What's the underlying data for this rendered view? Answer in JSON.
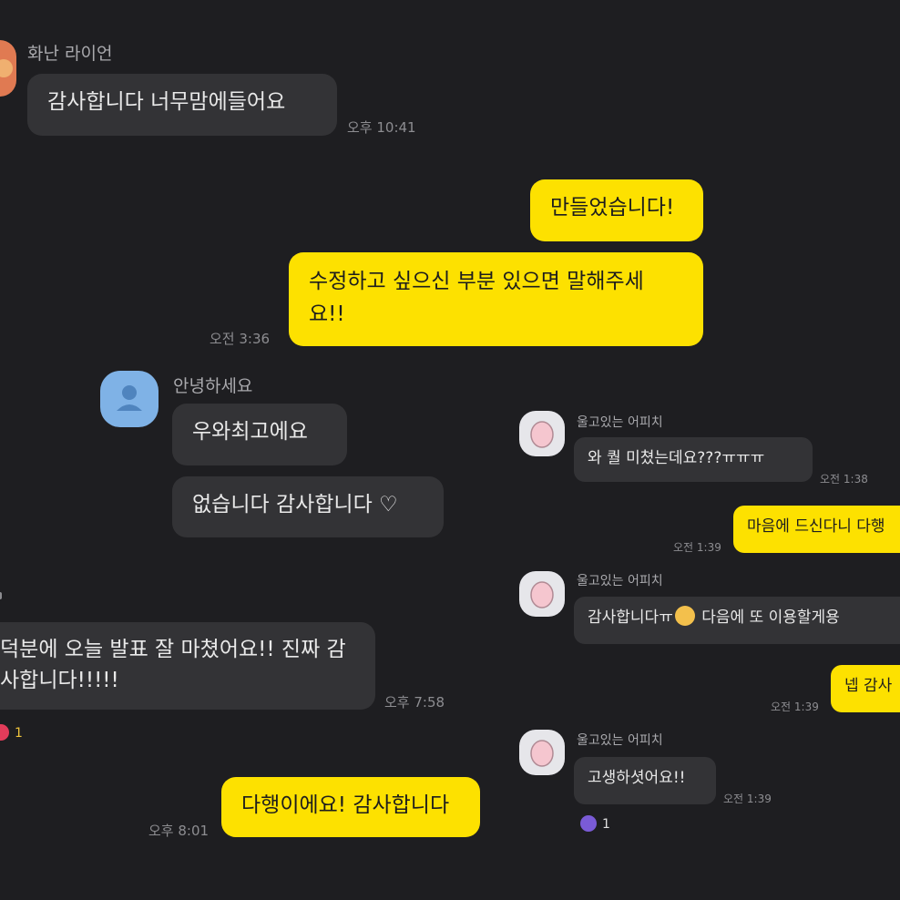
{
  "chats": {
    "hwanan": {
      "sender": "화난 라이언",
      "message": "감사합니다 너무맘에들어요",
      "time": "오후 10:41"
    },
    "mine1": {
      "messages": [
        "만들었습니다!",
        "수정하고 싶으신 부분 있으면 말해주세",
        "요!!"
      ],
      "time": "오전 3:36"
    },
    "annyeong": {
      "sender": "안녕하세요",
      "messages": [
        "우와최고에요",
        "없습니다 감사합니다 ♡"
      ]
    },
    "partial": {
      "message_lines": [
        "덕분에 오늘 발표 잘 마쳤어요!! 진짜 감",
        "사합니다!!!!!"
      ],
      "time": "오후 7:58",
      "reaction_count": "1",
      "reply": "다행이에요! 감사합니다",
      "reply_time": "오후 8:01"
    },
    "apeach": {
      "sender": "울고있는 어피치",
      "msg1": "와 퀄 미쳤는데요???ㅠㅠㅠ",
      "time1": "오전 1:38",
      "reply1": "마음에 드신다니 다행",
      "reply1_time": "오전 1:39",
      "msg2_a": "감사합니다ㅠ",
      "msg2_b": "다음에 또 이용할게용",
      "reply2": "넵 감사",
      "reply2_time": "오전 1:39",
      "msg3": "고생하셧어요!!",
      "time3": "오전 1:39",
      "reaction_count": "1"
    }
  },
  "colors": {
    "background": "#1e1e21",
    "bubble_dark": "#333336",
    "bubble_yellow": "#fde100"
  }
}
